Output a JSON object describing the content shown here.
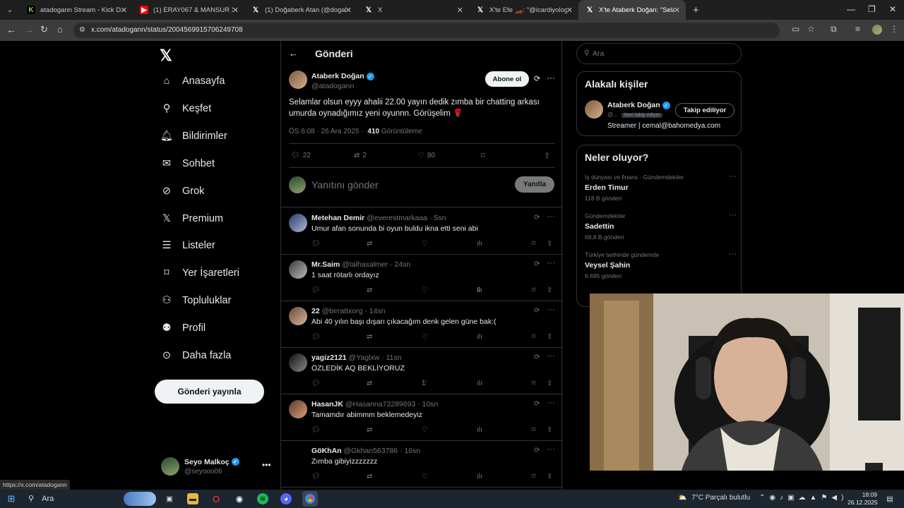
{
  "browser": {
    "tabs": [
      {
        "title": "atadogann Stream - Kick Dashb",
        "icon": "kick-icon",
        "color": "#53fc18"
      },
      {
        "title": "(1) ERAY067 & MANSUR X ORC",
        "icon": "youtube-icon",
        "color": "#ff0000"
      },
      {
        "title": "(1) Doğaberk Atan (@dogaberk",
        "icon": "x-icon",
        "color": "#ffffff"
      },
      {
        "title": "X",
        "icon": "x-icon",
        "color": "#ffffff"
      },
      {
        "title": "X'te Efe 🏎️: \"@icardiyologist2",
        "icon": "x-icon",
        "color": "#ffffff"
      },
      {
        "title": "X'te Ataberk Doğan: \"Selamlar o",
        "icon": "x-icon",
        "color": "#ffffff"
      }
    ],
    "url": "x.com/atadogann/status/2004569915706249708",
    "status_url": "https://x.com/atadogann"
  },
  "sidebar": {
    "items": [
      {
        "label": "Anasayfa",
        "icon": "home-icon"
      },
      {
        "label": "Keşfet",
        "icon": "search-icon"
      },
      {
        "label": "Bildirimler",
        "icon": "bell-icon"
      },
      {
        "label": "Sohbet",
        "icon": "mail-icon"
      },
      {
        "label": "Grok",
        "icon": "grok-icon"
      },
      {
        "label": "Premium",
        "icon": "x-icon"
      },
      {
        "label": "Listeler",
        "icon": "list-icon"
      },
      {
        "label": "Yer İşaretleri",
        "icon": "bookmark-icon"
      },
      {
        "label": "Topluluklar",
        "icon": "people-icon"
      },
      {
        "label": "Profil",
        "icon": "person-icon"
      },
      {
        "label": "Daha fazla",
        "icon": "more-circle-icon"
      }
    ],
    "post_button": "Gönderi yayınla",
    "me": {
      "name": "Seyo Malkoç",
      "handle": "@seyooo06"
    }
  },
  "main": {
    "title": "Gönderi",
    "post": {
      "author": "Ataberk Doğan",
      "handle": "@atadogann",
      "follow": "Abone ol",
      "text": "Selamlar olsun eyyy ahalii 22.00 yayın dedik zımba bir chatting arkası umurda oynadığımız yeni oyunnn. Görüşelim 🌹",
      "time": "ÖS 6:08 · 26 Ara 2025 ·",
      "views": "410",
      "views_label": "Görüntüleme",
      "replies": "22",
      "reposts": "2",
      "likes": "80"
    },
    "composer": {
      "placeholder": "Yanıtını gönder",
      "button": "Yanıtla"
    },
    "replies": [
      {
        "name": "Metehan Demir",
        "handle": "@everestmarkaaa",
        "time": "· 5sn",
        "text": "Umur afan sonunda bi oyun buldu ikna etti seni abi",
        "likes": "",
        "views": ""
      },
      {
        "name": "Mr.Saim",
        "handle": "@talhasalmer",
        "time": "· 24sn",
        "text": "1 saat rötarlı ordayız",
        "likes": "",
        "views": "8"
      },
      {
        "name": "22",
        "handle": "@berattxorg",
        "time": "· 14sn",
        "text": "Abi 40 yılın başı dışarı çıkacağım denk gelen güne bak:(",
        "likes": "",
        "views": ""
      },
      {
        "name": "yagiz2121",
        "handle": "@Yaglxw",
        "time": "· 11sn",
        "text": "ÖZLEDİK AQ BEKLİYORUZ",
        "likes": "1",
        "views": ""
      },
      {
        "name": "HasanJK",
        "handle": "@Hasanna73289693",
        "time": "· 10sn",
        "text": "Tamamdır abimmm beklemedeyiz",
        "likes": "",
        "views": ""
      },
      {
        "name": "GöKhAn",
        "handle": "@Gkhan563786",
        "time": "· 16sn",
        "text": "Zımba gibiyizzzzzzz",
        "likes": "",
        "views": ""
      }
    ]
  },
  "right": {
    "search_placeholder": "Ara",
    "related": {
      "title": "Alakalı kişiler",
      "name": "Ataberk Doğan",
      "handle": "@...",
      "follows_you": "Seni takip ediyor",
      "follow_btn": "Takip ediliyor",
      "bio": "Streamer | cemal@bahomedya.com"
    },
    "trends": {
      "title": "Neler oluyor?",
      "items": [
        {
          "context": "İş dünyası ve finans · Gündemdekiler",
          "topic": "Erden Timur",
          "count": "118 B gönderi"
        },
        {
          "context": "Gündemdekiler",
          "topic": "Sadettin",
          "count": "68,8 B gönderi"
        },
        {
          "context": "Türkiye tarihinde gündemde",
          "topic": "Veysel Şahin",
          "count": "6.695 gönderi"
        }
      ]
    }
  },
  "taskbar": {
    "search": "Ara",
    "weather": "7°C  Parçalı bulutlu",
    "time": "18:09",
    "date": "26.12.2025"
  }
}
